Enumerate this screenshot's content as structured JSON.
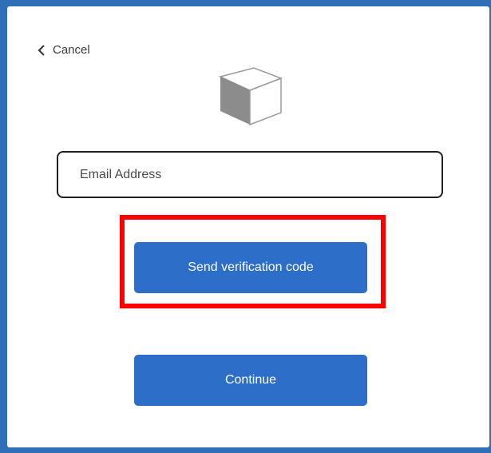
{
  "header": {
    "cancel_label": "Cancel",
    "back_icon": "chevron-left-icon",
    "logo_icon": "cube-icon"
  },
  "form": {
    "email_placeholder": "Email Address",
    "email_value": ""
  },
  "actions": {
    "send_code_label": "Send verification code",
    "continue_label": "Continue"
  },
  "colors": {
    "frame": "#2f6fb8",
    "button": "#2d6fc8",
    "highlight": "#ff0000"
  }
}
